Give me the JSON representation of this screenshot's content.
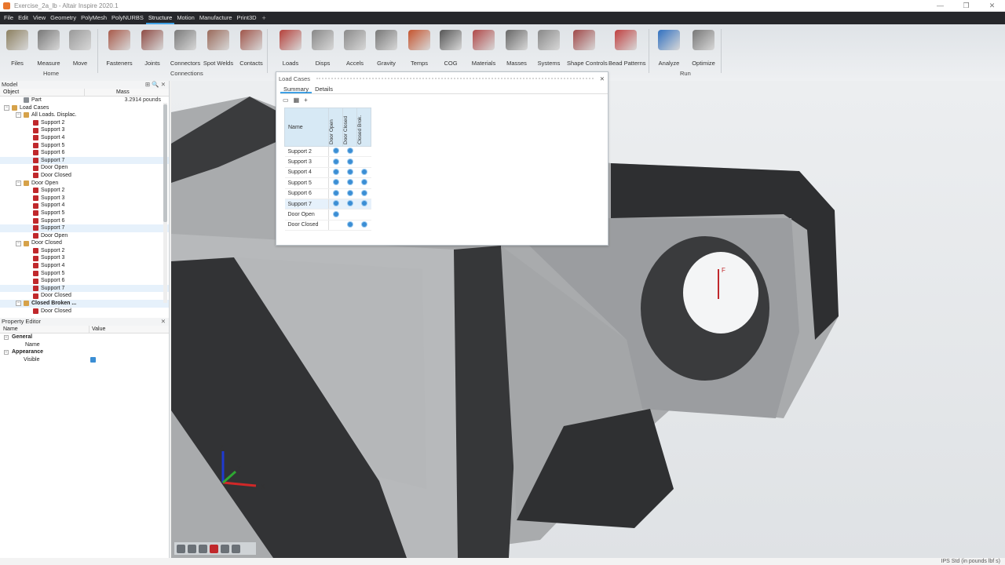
{
  "window": {
    "title": "Exercise_2a_lb - Altair Inspire 2020.1"
  },
  "menu": [
    "File",
    "Edit",
    "View",
    "Geometry",
    "PolyMesh",
    "PolyNURBS",
    "Structure",
    "Motion",
    "Manufacture",
    "Print3D",
    "+"
  ],
  "ribbon": {
    "tools": [
      "Files",
      "Measure",
      "Move",
      "Fasteners",
      "Joints",
      "Connectors",
      "Spot Welds",
      "Contacts",
      "Loads",
      "Disps",
      "Accels",
      "Gravity",
      "Temps",
      "COG",
      "Materials",
      "Masses",
      "Systems",
      "Shape Controls",
      "Bead Patterns",
      "Analyze",
      "Optimize"
    ],
    "groups": [
      "Home",
      "Connections",
      "Run"
    ]
  },
  "model": {
    "title": "Model",
    "columns": [
      "Object",
      "Mass"
    ],
    "rows": [
      {
        "label": "Part",
        "mass": "3.2914 pounds"
      },
      {
        "label": "Load Cases"
      },
      {
        "label": "All Loads. Displac."
      },
      {
        "label": "Support 2"
      },
      {
        "label": "Support 3"
      },
      {
        "label": "Support 4"
      },
      {
        "label": "Support 5"
      },
      {
        "label": "Support 6"
      },
      {
        "label": "Support 7"
      },
      {
        "label": "Door Open"
      },
      {
        "label": "Door Closed"
      },
      {
        "label": "Door Open"
      },
      {
        "label": "Support 2"
      },
      {
        "label": "Support 3"
      },
      {
        "label": "Support 4"
      },
      {
        "label": "Support 5"
      },
      {
        "label": "Support 6"
      },
      {
        "label": "Support 7"
      },
      {
        "label": "Door Open"
      },
      {
        "label": "Door Closed"
      },
      {
        "label": "Support 2"
      },
      {
        "label": "Support 3"
      },
      {
        "label": "Support 4"
      },
      {
        "label": "Support 5"
      },
      {
        "label": "Support 6"
      },
      {
        "label": "Support 7"
      },
      {
        "label": "Door Closed"
      },
      {
        "label": "Closed Broken ..."
      },
      {
        "label": "Door Closed"
      }
    ]
  },
  "property_editor": {
    "title": "Property Editor",
    "columns": [
      "Name",
      "Value"
    ],
    "general": "General",
    "name_label": "Name",
    "appearance": "Appearance",
    "visible_label": "Visible"
  },
  "load_cases": {
    "title": "Load Cases",
    "tabs": [
      "Summary",
      "Details"
    ],
    "name_header": "Name",
    "col_headers": [
      "Door Open",
      "Door Closed",
      "Closed Brok."
    ],
    "rows": [
      {
        "name": "Support 2",
        "c": [
          true,
          true,
          false
        ]
      },
      {
        "name": "Support 3",
        "c": [
          true,
          true,
          false
        ]
      },
      {
        "name": "Support 4",
        "c": [
          true,
          true,
          true
        ]
      },
      {
        "name": "Support 5",
        "c": [
          true,
          true,
          true
        ]
      },
      {
        "name": "Support 6",
        "c": [
          true,
          true,
          true
        ]
      },
      {
        "name": "Support 7",
        "c": [
          true,
          true,
          true
        ]
      },
      {
        "name": "Door Open",
        "c": [
          true,
          false,
          false
        ]
      },
      {
        "name": "Door Closed",
        "c": [
          false,
          true,
          true
        ]
      }
    ]
  },
  "axes": {
    "z": "Z",
    "x": "X",
    "y": "Y"
  },
  "force_label": "F",
  "status": "IPS Std (in pounds lbf s)",
  "colors": {
    "menubar": "#26272b",
    "accent": "#3fa1e6",
    "check": "#3b8ed4"
  }
}
